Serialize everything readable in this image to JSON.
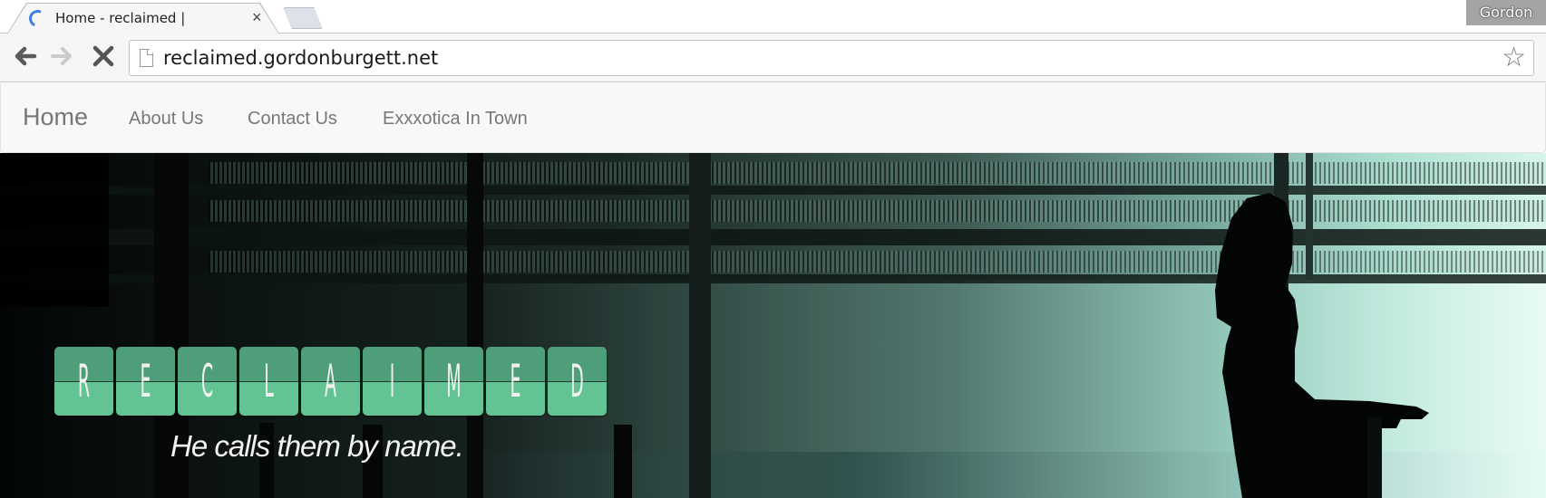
{
  "browser": {
    "tab": {
      "title": "Home - reclaimed |",
      "close_glyph": "×",
      "status_icon": "loading-spinner"
    },
    "profile_name": "Gordon",
    "toolbar": {
      "back_glyph": "🡐",
      "forward_glyph": "🡒",
      "stop_glyph": "✕",
      "url": "reclaimed.gordonburgett.net",
      "bookmark_glyph": "☆"
    }
  },
  "site": {
    "nav": {
      "brand": "Home",
      "links": [
        "About Us",
        "Contact Us",
        "Exxxotica In Town"
      ]
    },
    "hero": {
      "logo_letters": [
        "R",
        "E",
        "C",
        "L",
        "A",
        "I",
        "M",
        "E",
        "D"
      ],
      "tagline": "He calls them by name.",
      "colors": {
        "tile_top": "#4e9f79",
        "tile_bottom": "#64c393",
        "letter": "#f0f0f0"
      }
    }
  }
}
